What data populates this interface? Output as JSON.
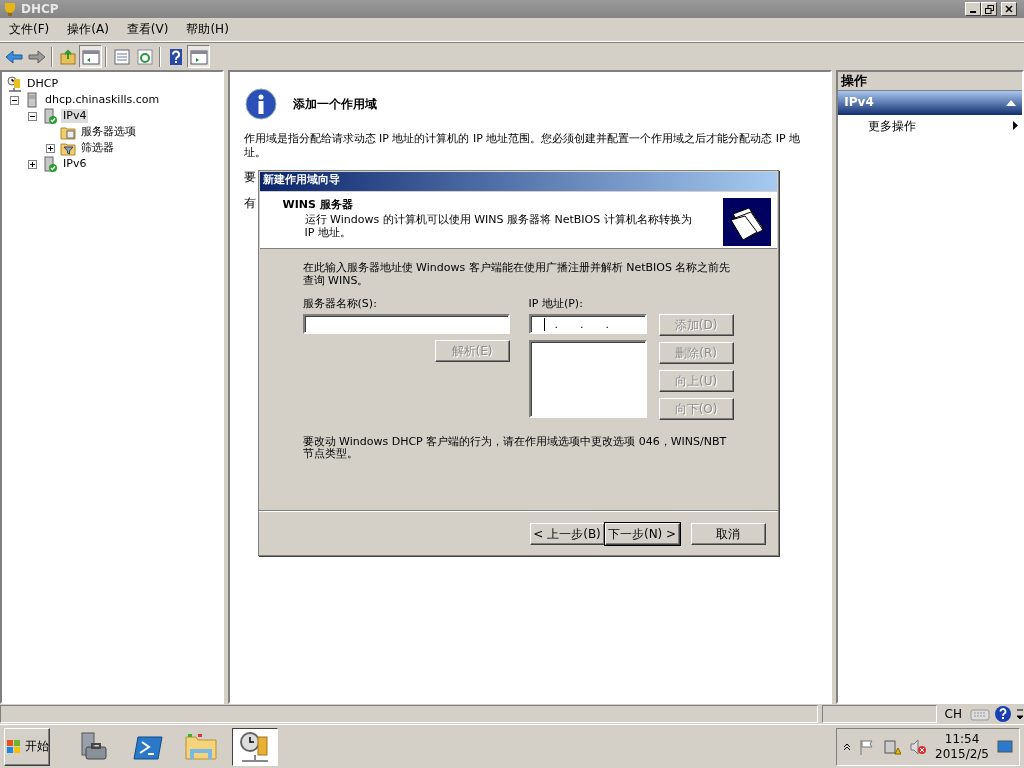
{
  "window": {
    "title": "DHCP"
  },
  "menu": [
    {
      "label": "文件(F)"
    },
    {
      "label": "操作(A)"
    },
    {
      "label": "查看(V)"
    },
    {
      "label": "帮助(H)"
    }
  ],
  "tree": [
    {
      "label": "DHCP",
      "kind": "root",
      "selected": false,
      "children": [
        {
          "label": "dhcp.chinaskills.com",
          "kind": "server",
          "expanded": true,
          "selected": false,
          "children": [
            {
              "label": "IPv4",
              "kind": "ip",
              "expanded": true,
              "selected": true,
              "children": [
                {
                  "label": "服务器选项",
                  "kind": "options",
                  "selected": false
                },
                {
                  "label": "筛选器",
                  "kind": "filter",
                  "expanded": false,
                  "selected": false
                }
              ]
            },
            {
              "label": "IPv6",
              "kind": "ip",
              "expanded": false,
              "selected": false
            }
          ]
        }
      ]
    }
  ],
  "content": {
    "heading": "添加一个作用域",
    "description": "作用域是指分配给请求动态 IP 地址的计算机的 IP 地址范围。您必须创建并配置一个作用域之后才能分配动态 IP 地址。",
    "covered_lines": [
      "要",
      "有"
    ]
  },
  "dialog": {
    "title": "新建作用域向导",
    "header_title": "WINS 服务器",
    "header_subtitle": "运行 Windows 的计算机可以使用 WINS 服务器将 NetBIOS 计算机名称转换为 IP 地址。",
    "intro": "在此输入服务器地址使 Windows 客户端能在使用广播注册并解析 NetBIOS 名称之前先查询 WINS。",
    "server_name_label": "服务器名称(S):",
    "ip_label": "IP 地址(P):",
    "ip_separators": [
      ".",
      ".",
      "."
    ],
    "resolve_button": {
      "label": "解析(E)",
      "disabled": true
    },
    "side_buttons": [
      {
        "label": "添加(D)",
        "disabled": true
      },
      {
        "label": "删除(R)",
        "disabled": true
      },
      {
        "label": "向上(U)",
        "disabled": true
      },
      {
        "label": "向下(O)",
        "disabled": true
      }
    ],
    "note": "要改动 Windows DHCP 客户端的行为，请在作用域选项中更改选项 046，WINS/NBT 节点类型。",
    "nav_buttons": [
      {
        "label": "< 上一步(B)",
        "default": false
      },
      {
        "label": "下一步(N) >",
        "default": true
      },
      {
        "label": "取消",
        "default": false
      }
    ]
  },
  "actions": {
    "title": "操作",
    "sections": [
      {
        "label": "IPv4",
        "expanded": true,
        "items": [
          {
            "label": "更多操作",
            "submenu": true
          }
        ]
      }
    ]
  },
  "status_bar": {
    "language": "CH"
  },
  "taskbar": {
    "start": "开始",
    "apps": [
      {
        "kind": "server-manager",
        "active": false
      },
      {
        "kind": "powershell",
        "active": false
      },
      {
        "kind": "explorer",
        "active": false
      },
      {
        "kind": "dhcp",
        "active": true
      }
    ],
    "clock_time": "11:54",
    "clock_date": "2015/2/5"
  }
}
